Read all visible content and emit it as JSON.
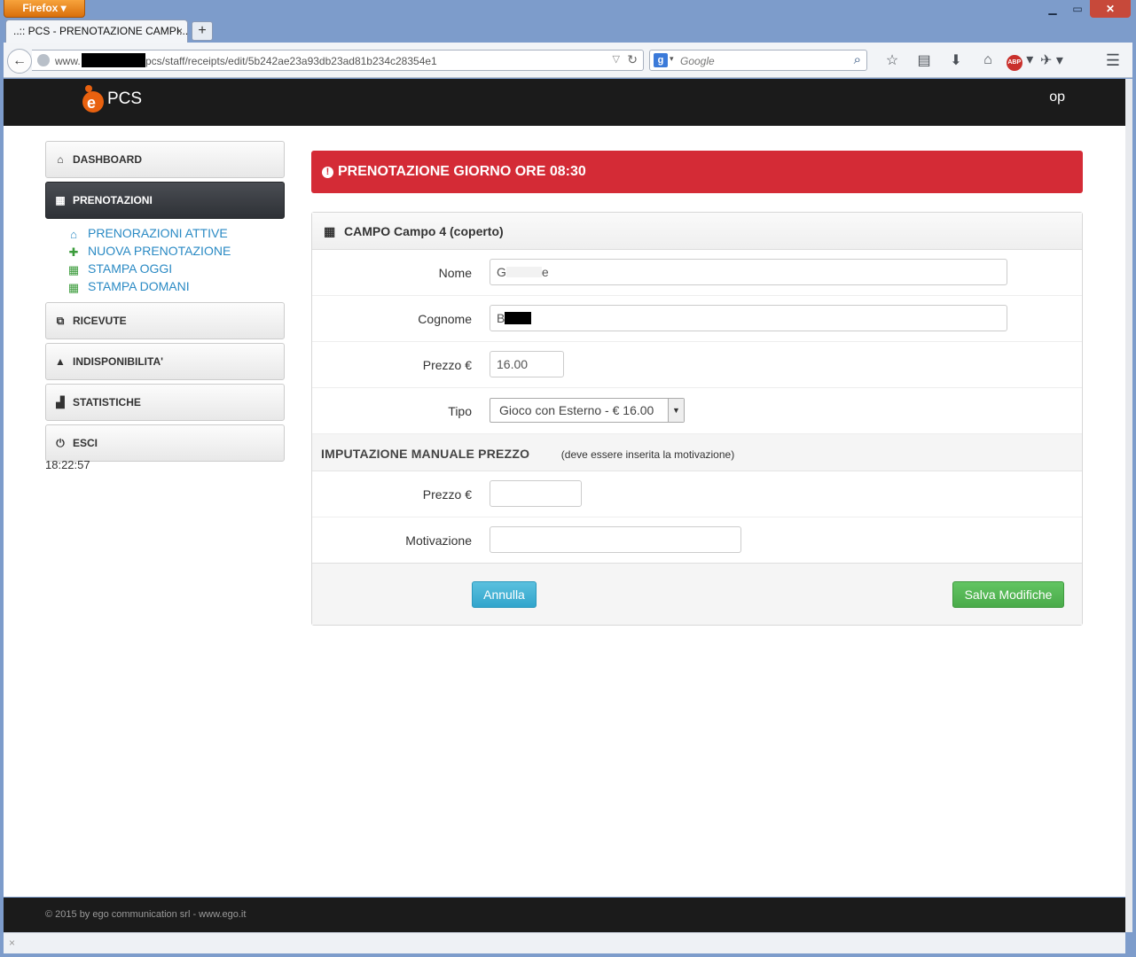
{
  "browser": {
    "menu_button": "Firefox",
    "tab_title": "..:: PCS - PRENOTAZIONE CAMPI...",
    "tab_close": "×",
    "new_tab": "+",
    "url_prefix": "www.",
    "url_path": "pcs/staff/receipts/edit/5b242ae23a93db23ad81b234c28354e1",
    "search_placeholder": "Google",
    "search_engine_icon": "g",
    "window_controls": [
      "minimize-icon",
      "maximize-icon",
      "close-icon"
    ]
  },
  "header": {
    "brand": "PCS",
    "user": "op"
  },
  "sidebar": {
    "items": [
      {
        "label": "DASHBOARD",
        "icon": "home-icon",
        "glyph": "⌂"
      },
      {
        "label": "PRENOTAZIONI",
        "icon": "calendar-icon",
        "glyph": "▦",
        "active": true
      },
      {
        "label": "RICEVUTE",
        "icon": "copy-icon",
        "glyph": "⧉"
      },
      {
        "label": "INDISPONIBILITA'",
        "icon": "warning-icon",
        "glyph": "▲"
      },
      {
        "label": "STATISTICHE",
        "icon": "bar-chart-icon",
        "glyph": "▟"
      },
      {
        "label": "ESCI",
        "icon": "power-icon",
        "glyph": "⏻"
      }
    ],
    "subitems": [
      {
        "label": "PRENORAZIONI ATTIVE",
        "icon": "home-icon",
        "glyph": "⌂",
        "color": "#2a8ac4"
      },
      {
        "label": "NUOVA PRENOTAZIONE",
        "icon": "plus-icon",
        "glyph": "✚",
        "color": "#3a9b3a"
      },
      {
        "label": "STAMPA OGGI",
        "icon": "table-icon",
        "glyph": "▦",
        "color": "#3a9b3a"
      },
      {
        "label": "STAMPA DOMANI",
        "icon": "table-icon",
        "glyph": "▦",
        "color": "#3a9b3a"
      }
    ],
    "clock": "18:22:57"
  },
  "alert": {
    "text": "PRENOTAZIONE GIORNO ORE 08:30",
    "icon": "exclamation-circle-icon",
    "color": "#d42b36"
  },
  "panel": {
    "title": "CAMPO Campo 4 (coperto)",
    "icon": "calendar-icon",
    "fields": {
      "nome_label": "Nome",
      "nome_value_start": "G",
      "nome_value_end": "e",
      "cognome_label": "Cognome",
      "cognome_value_start": "B",
      "prezzo_label": "Prezzo €",
      "prezzo_value": "16.00",
      "tipo_label": "Tipo",
      "tipo_value": "Gioco con Esterno - € 16.00"
    },
    "manual": {
      "title": "IMPUTAZIONE MANUALE PREZZO",
      "note": "(deve essere inserita la motivazione)",
      "prezzo_label": "Prezzo €",
      "prezzo_value": "",
      "motivazione_label": "Motivazione",
      "motivazione_value": ""
    },
    "buttons": {
      "cancel": "Annulla",
      "save": "Salva Modifiche"
    }
  },
  "footer": {
    "text": "© 2015 by ego communication srl - www.ego.it"
  }
}
